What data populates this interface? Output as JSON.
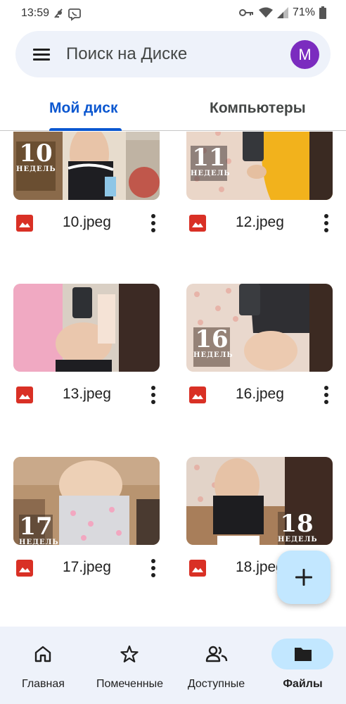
{
  "status_bar": {
    "time": "13:59",
    "battery": "71%"
  },
  "search": {
    "placeholder": "Поиск на Диске",
    "avatar_letter": "M"
  },
  "tabs": [
    {
      "label": "Мой диск",
      "active": true
    },
    {
      "label": "Компьютеры",
      "active": false
    }
  ],
  "files": [
    {
      "name": "10.jpeg",
      "week": "10",
      "week_word": "НЕДЕЛЬ"
    },
    {
      "name": "12.jpeg",
      "week": "11",
      "week_word": "НЕДЕЛЬ"
    },
    {
      "name": "13.jpeg"
    },
    {
      "name": "16.jpeg",
      "week": "16",
      "week_word": "НЕДЕЛЬ"
    },
    {
      "name": "17.jpeg",
      "week": "17",
      "week_word": "НЕДЕЛЬ"
    },
    {
      "name": "18.jpeg",
      "week": "18",
      "week_word": "НЕДЕЛЬ"
    }
  ],
  "nav": [
    {
      "label": "Главная",
      "icon": "home-icon"
    },
    {
      "label": "Помеченные",
      "icon": "star-icon"
    },
    {
      "label": "Доступные",
      "icon": "people-icon"
    },
    {
      "label": "Файлы",
      "icon": "folder-icon",
      "active": true
    }
  ],
  "colors": {
    "accent": "#0b57d0",
    "avatar": "#7b2cbf",
    "image_icon": "#d93025",
    "fab": "#c2e7ff"
  }
}
